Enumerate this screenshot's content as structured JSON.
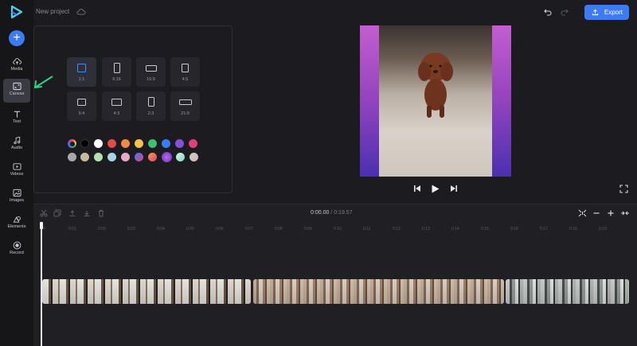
{
  "header": {
    "project_title": "New project",
    "export_label": "Export"
  },
  "rail": {
    "items": [
      {
        "label": "Media",
        "icon": "cloud-upload-icon"
      },
      {
        "label": "Canvas",
        "icon": "canvas-icon",
        "active": true
      },
      {
        "label": "Text",
        "icon": "text-icon"
      },
      {
        "label": "Audio",
        "icon": "music-note-icon"
      },
      {
        "label": "Videos",
        "icon": "video-icon"
      },
      {
        "label": "Images",
        "icon": "image-icon"
      },
      {
        "label": "Elements",
        "icon": "shapes-icon"
      },
      {
        "label": "Record",
        "icon": "record-icon"
      }
    ]
  },
  "canvas_panel": {
    "ratios": [
      {
        "label": "1:1",
        "selected": true
      },
      {
        "label": "9:16"
      },
      {
        "label": "16:9"
      },
      {
        "label": "4:5"
      },
      {
        "label": "5:4"
      },
      {
        "label": "4:3"
      },
      {
        "label": "2:3"
      },
      {
        "label": "21:9"
      }
    ],
    "colors_row1": [
      "rainbow",
      "#000000",
      "#ffffff",
      "#e04b4b",
      "#f08a4b",
      "#f2c14e",
      "#3fbf6f",
      "#3d7bf5",
      "#8a4fd8",
      "#e0407a"
    ],
    "colors_row2": [
      "#a7a7ad",
      "#c8b89e",
      "#b5e0b0",
      "#a8d4e8",
      "#e8a8c8",
      "gradient-blue-pink",
      "gradient-orange-pink",
      "gradient-purple",
      "gradient-teal",
      "gradient-green-pink"
    ]
  },
  "timeline": {
    "current_time": "0:00.00",
    "separator": "/",
    "total_time": "0:19.57",
    "ruler": [
      "0",
      "0:01",
      "0:02",
      "0:03",
      "0:04",
      "0:05",
      "0:06",
      "0:07",
      "0:08",
      "0:09",
      "0:10",
      "0:11",
      "0:12",
      "0:13",
      "0:14",
      "0:15",
      "0:16",
      "0:17",
      "0:18",
      "0:19"
    ]
  },
  "colors": {
    "accent": "#3d7bf5",
    "background": "#1b1b20",
    "annotation_arrow": "#2fd58a"
  }
}
